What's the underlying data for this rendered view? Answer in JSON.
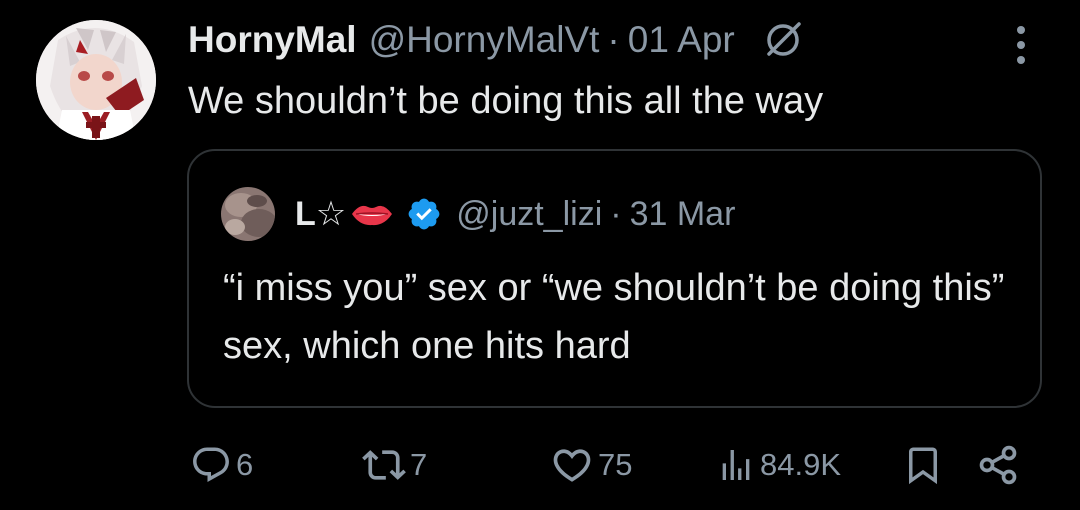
{
  "tweet": {
    "author_name": "HornyMal",
    "author_handle": "@HornyMalVt",
    "separator": "·",
    "date": "01 Apr",
    "text": "We shouldn’t be doing this all the way"
  },
  "quoted_tweet": {
    "author_name": "L☆",
    "author_handle": "@juzt_lizi",
    "separator": "·",
    "date": "31 Mar",
    "text": "“i miss you” sex or “we shouldn’t be doing this” sex, which one hits hard",
    "verified": true
  },
  "actions": {
    "replies": "6",
    "retweets": "7",
    "likes": "75",
    "views": "84.9K"
  },
  "icons": {
    "grok": "grok-slash-circle-icon",
    "more": "more-vertical-icon",
    "lips": "lips-emoji-icon",
    "verified": "verified-badge-icon",
    "reply": "reply-icon",
    "retweet": "retweet-icon",
    "like": "heart-icon",
    "views": "views-icon",
    "bookmark": "bookmark-icon",
    "share": "share-icon"
  },
  "colors": {
    "background": "#000000",
    "text_primary": "#e7e9ea",
    "text_secondary": "#8b98a5",
    "border": "#2f3336",
    "verified_blue": "#1d9bf0"
  }
}
